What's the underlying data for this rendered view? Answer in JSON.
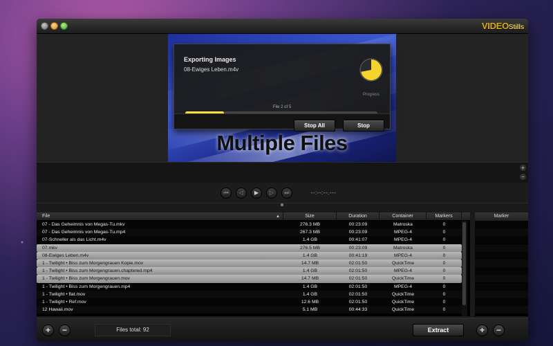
{
  "app": {
    "logo_main": "VIDEO",
    "logo_sub": "Stills",
    "preview_title": "Multiple Files"
  },
  "progress": {
    "title": "Exporting Images",
    "current_file": "08-Ewiges Leben.m4v",
    "progress_label": "Progress",
    "file_counter": "File 2 of 5",
    "fraction": 0.2,
    "pie_fraction": 0.72,
    "stop_all_label": "Stop All",
    "stop_label": "Stop",
    "accent_color": "#f5d52c"
  },
  "transport": {
    "timecode": "--:--:--.---"
  },
  "table": {
    "columns": {
      "file": "File",
      "size": "Size",
      "duration": "Duration",
      "container": "Container",
      "markers": "Markers"
    },
    "rows": [
      {
        "file": "07 - Das Geheimnis von Megas-Tu.mkv",
        "size": "276.3 MB",
        "duration": "00:23:09",
        "container": "Matroska",
        "markers": "0",
        "selected": false
      },
      {
        "file": "07 - Das Geheimnis von Megas-Tu.mp4",
        "size": "267.3 MB",
        "duration": "00:23:09",
        "container": "MPEG-4",
        "markers": "0",
        "selected": false
      },
      {
        "file": "07-Schneller als das Licht.m4v",
        "size": "1.4 GB",
        "duration": "00:41:07",
        "container": "MPEG-4",
        "markers": "0",
        "selected": false
      },
      {
        "file": "07.mkv",
        "size": "276.5 MB",
        "duration": "00:23:09",
        "container": "Matroska",
        "markers": "0",
        "selected": true
      },
      {
        "file": "08-Ewiges Leben.m4v",
        "size": "1.4 GB",
        "duration": "00:41:19",
        "container": "MPEG-4",
        "markers": "0",
        "selected": true
      },
      {
        "file": "1 - Twilight • Biss zum Morgengrauen Kopie.mov",
        "size": "14.7 MB",
        "duration": "02:01:50",
        "container": "QuickTime",
        "markers": "0",
        "selected": true
      },
      {
        "file": "1 - Twilight • Biss zum Morgengrauen.chaptered.mp4",
        "size": "1.4 GB",
        "duration": "02:01:50",
        "container": "MPEG-4",
        "markers": "0",
        "selected": true
      },
      {
        "file": "1 - Twilight • Biss zum Morgengrauen.mov",
        "size": "14.7 MB",
        "duration": "02:01:50",
        "container": "QuickTime",
        "markers": "0",
        "selected": true
      },
      {
        "file": "1 - Twilight • Biss zum Morgengrauen.mp4",
        "size": "1.4 GB",
        "duration": "02:01:50",
        "container": "MPEG-4",
        "markers": "0",
        "selected": false
      },
      {
        "file": "1 - Twilight • flat.mov",
        "size": "1.4 GB",
        "duration": "02:01:50",
        "container": "QuickTime",
        "markers": "0",
        "selected": false
      },
      {
        "file": "1 - Twilight • Ref.mov",
        "size": "12.6 MB",
        "duration": "02:01:50",
        "container": "QuickTime",
        "markers": "0",
        "selected": false
      },
      {
        "file": "12 Hawaii.mov",
        "size": "5.1 MB",
        "duration": "00:44:33",
        "container": "QuickTime",
        "markers": "0",
        "selected": false
      }
    ]
  },
  "marker_panel": {
    "header": "Marker"
  },
  "footer": {
    "add_symbol": "+",
    "remove_symbol": "−",
    "files_total": "Files total: 92",
    "extract_label": "Extract"
  },
  "icons": {
    "skip_back": "skip-to-start-icon",
    "step_back": "step-back-icon",
    "play": "play-icon",
    "step_forward": "step-forward-icon",
    "skip_forward": "skip-to-end-icon"
  }
}
